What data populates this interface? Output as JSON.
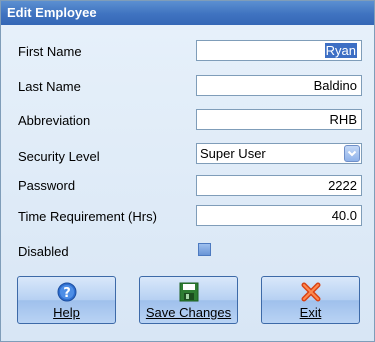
{
  "window": {
    "title": "Edit Employee"
  },
  "form": {
    "first_name": {
      "label": "First Name",
      "value_pre": "",
      "value_selected": "Ryan"
    },
    "last_name": {
      "label": "Last Name",
      "value": "Baldino"
    },
    "abbreviation": {
      "label": "Abbreviation",
      "value": "RHB"
    },
    "security_level": {
      "label": "Security Level",
      "value": "Super User"
    },
    "password": {
      "label": "Password",
      "value": "2222"
    },
    "time_requirement": {
      "label": "Time Requirement (Hrs)",
      "value": "40.0"
    },
    "disabled": {
      "label": "Disabled",
      "checked": false
    }
  },
  "buttons": {
    "help": {
      "label": "Help",
      "icon": "help-icon"
    },
    "save": {
      "label": "Save Changes",
      "icon": "save-disk-icon"
    },
    "exit": {
      "label": "Exit",
      "icon": "exit-x-icon"
    }
  },
  "colors": {
    "title_bar": "#3f73c0",
    "background": "#dce9f6",
    "selection": "#3d6fc4"
  }
}
